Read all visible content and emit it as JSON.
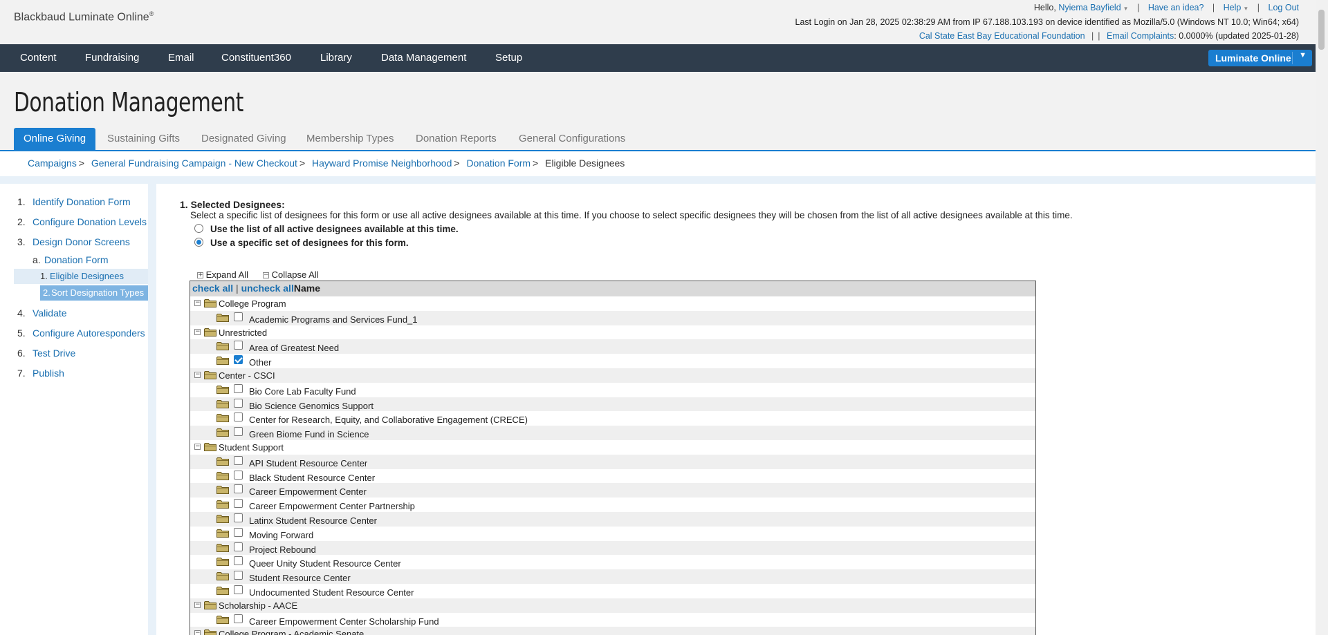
{
  "header": {
    "logo": "Blackbaud Luminate Online",
    "logo_mark": "®",
    "hello": "Hello,",
    "user_name": "Nyiema Bayfield",
    "have_idea": "Have an idea?",
    "help": "Help",
    "logout": "Log Out",
    "last_login": "Last Login on Jan 28, 2025 02:38:29 AM from IP 67.188.103.193 on device identified as Mozilla/5.0 (Windows NT 10.0; Win64; x64)",
    "org_name": "Cal State East Bay Educational Foundation",
    "email_complaints_label": "Email Complaints",
    "email_complaints_value": ": 0.0000% (updated 2025-01-28)"
  },
  "nav": {
    "items": [
      "Content",
      "Fundraising",
      "Email",
      "Constituent360",
      "Library",
      "Data Management",
      "Setup"
    ],
    "product_button": "Luminate Online"
  },
  "page": {
    "title": "Donation Management",
    "tabs": [
      "Online Giving",
      "Sustaining Gifts",
      "Designated Giving",
      "Membership Types",
      "Donation Reports",
      "General Configurations"
    ],
    "active_tab": "Online Giving"
  },
  "breadcrumb": {
    "links": [
      "Campaigns",
      "General Fundraising Campaign - New Checkout",
      "Hayward Promise Neighborhood",
      "Donation Form"
    ],
    "current": "Eligible Designees"
  },
  "sidebar": {
    "steps": [
      {
        "num": "1.",
        "label": "Identify Donation Form"
      },
      {
        "num": "2.",
        "label": "Configure Donation Levels"
      },
      {
        "num": "3.",
        "label": "Design Donor Screens"
      },
      {
        "num": "a.",
        "label": "Donation Form"
      },
      {
        "num": "1.",
        "label": "Eligible Designees"
      },
      {
        "num": "2.",
        "label": "Sort Designation Types"
      },
      {
        "num": "4.",
        "label": "Validate"
      },
      {
        "num": "5.",
        "label": "Configure Autoresponders"
      },
      {
        "num": "6.",
        "label": "Test Drive"
      },
      {
        "num": "7.",
        "label": "Publish"
      }
    ]
  },
  "main": {
    "section_title": "1. Selected Designees:",
    "description": "Select a specific list of designees for this form or use all active designees available at this time. If you choose to select specific designees they will be chosen from the list of all active designees available at this time.",
    "radio_all": "Use the list of all active designees available at this time.",
    "radio_specific": "Use a specific set of designees for this form.",
    "selected_option": "specific",
    "expand_all": "Expand All",
    "collapse_all": "Collapse All",
    "check_all": "check all",
    "uncheck_all": "uncheck all",
    "pipe": "|",
    "name_header": "Name",
    "tree": [
      {
        "type": "group",
        "label": "College Program"
      },
      {
        "type": "item",
        "label": "Academic Programs and Services Fund_1",
        "checked": false
      },
      {
        "type": "group",
        "label": "Unrestricted"
      },
      {
        "type": "item",
        "label": "Area of Greatest Need",
        "checked": false
      },
      {
        "type": "item",
        "label": "Other",
        "checked": true
      },
      {
        "type": "group",
        "label": "Center - CSCI"
      },
      {
        "type": "item",
        "label": "Bio Core Lab Faculty Fund",
        "checked": false
      },
      {
        "type": "item",
        "label": "Bio Science Genomics Support",
        "checked": false
      },
      {
        "type": "item",
        "label": "Center for Research, Equity, and Collaborative Engagement (CRECE)",
        "checked": false
      },
      {
        "type": "item",
        "label": "Green Biome Fund in Science",
        "checked": false
      },
      {
        "type": "group",
        "label": "Student Support"
      },
      {
        "type": "item",
        "label": "API Student Resource Center",
        "checked": false
      },
      {
        "type": "item",
        "label": "Black Student Resource Center",
        "checked": false
      },
      {
        "type": "item",
        "label": "Career Empowerment Center",
        "checked": false
      },
      {
        "type": "item",
        "label": "Career Empowerment Center Partnership",
        "checked": false
      },
      {
        "type": "item",
        "label": "Latinx Student Resource Center",
        "checked": false
      },
      {
        "type": "item",
        "label": "Moving Forward",
        "checked": false
      },
      {
        "type": "item",
        "label": "Project Rebound",
        "checked": false
      },
      {
        "type": "item",
        "label": "Queer Unity Student Resource Center",
        "checked": false
      },
      {
        "type": "item",
        "label": "Student Resource Center",
        "checked": false
      },
      {
        "type": "item",
        "label": "Undocumented Student Resource Center",
        "checked": false
      },
      {
        "type": "group",
        "label": "Scholarship - AACE"
      },
      {
        "type": "item",
        "label": "Career Empowerment Center Scholarship Fund",
        "checked": false
      },
      {
        "type": "group",
        "label": "College Program - Academic Senate"
      }
    ]
  },
  "colors": {
    "accent": "#1a7ed0",
    "nav_bg": "#2f3d4c",
    "link": "#1a6fb0",
    "folder": "#c9b56a"
  }
}
